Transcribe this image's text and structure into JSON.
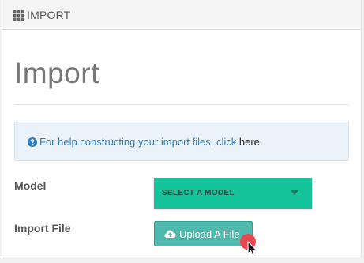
{
  "header": {
    "icon": "grid-icon",
    "title": "IMPORT"
  },
  "page": {
    "title": "Import"
  },
  "help": {
    "icon": "question-circle-icon",
    "text": "For help constructing your import files, click ",
    "link_text": "here."
  },
  "form": {
    "model_label": "Model",
    "model_select": {
      "value": "SELECT A MODEL",
      "icon": "chevron-down-icon"
    },
    "import_file_label": "Import File",
    "upload_button": {
      "icon": "cloud-upload-icon",
      "label": "Upload A File"
    }
  },
  "colors": {
    "select_bg": "#15c39a",
    "upload_bg": "#4fb9ae",
    "help_bg": "#eaf3fa",
    "help_text": "#2f7dbf",
    "click_indicator": "#e9484f"
  }
}
